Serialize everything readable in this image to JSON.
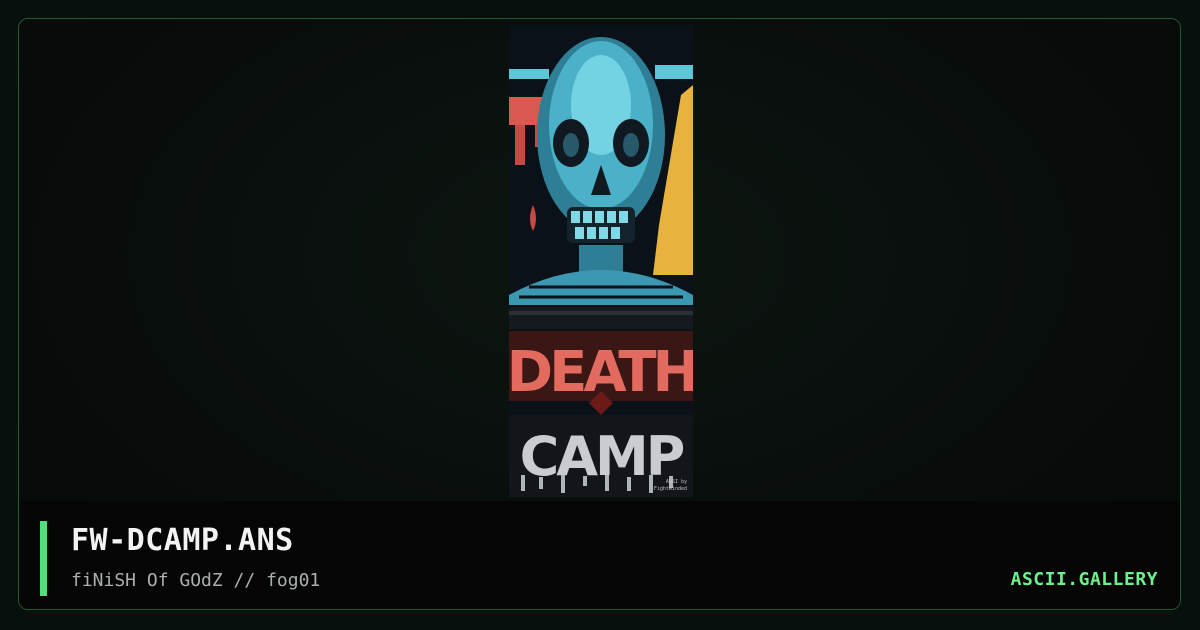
{
  "artwork": {
    "lettering": "DEATH CAMP",
    "credit": "ANSI by FightWinded"
  },
  "file": {
    "title": "FW-DCAMP.ANS",
    "subtitle": "fiNiSH Of GOdZ // fog01"
  },
  "site": {
    "brand": "ASCII.GALLERY"
  },
  "colors": {
    "accent": "#4ee07a",
    "brand": "#6ff08e",
    "frame_border": "#1f5a2c"
  }
}
